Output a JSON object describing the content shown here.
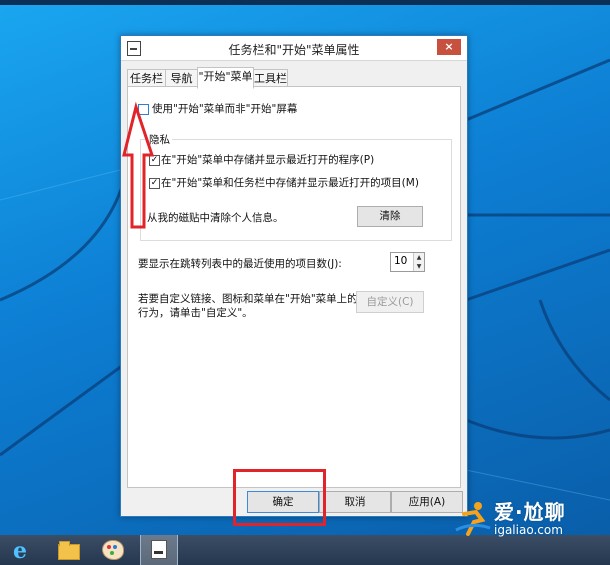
{
  "window": {
    "title": "任务栏和\"开始\"菜单属性",
    "close_glyph": "×"
  },
  "tabs": [
    {
      "label": "任务栏",
      "active": false
    },
    {
      "label": "导航",
      "active": false
    },
    {
      "label": "\"开始\"菜单",
      "active": true
    },
    {
      "label": "工具栏",
      "active": false
    }
  ],
  "start_menu": {
    "use_start_menu_label": "使用\"开始\"菜单而非\"开始\"屏幕",
    "use_start_menu_checked": false
  },
  "privacy": {
    "group_title": "隐私",
    "store_recent_programs_label": "在\"开始\"菜单中存储并显示最近打开的程序(P)",
    "store_recent_programs_checked": true,
    "store_recent_items_label": "在\"开始\"菜单和任务栏中存储并显示最近打开的项目(M)",
    "store_recent_items_checked": true,
    "clear_tiles_text": "从我的磁贴中清除个人信息。",
    "clear_button": "清除"
  },
  "jump_list": {
    "label": "要显示在跳转列表中的最近使用的项目数(J):",
    "value": "10"
  },
  "customize": {
    "text_line1": "若要自定义链接、图标和菜单在\"开始\"菜单上的外观和",
    "text_line2": "行为，请单击\"自定义\"。",
    "button": "自定义(C)"
  },
  "footer": {
    "ok": "确定",
    "cancel": "取消",
    "apply": "应用(A)"
  },
  "taskbar": {
    "items": [
      {
        "name": "internet-explorer",
        "icon": "ie-icon",
        "active": false
      },
      {
        "name": "file-explorer",
        "icon": "folder-icon",
        "active": false
      },
      {
        "name": "paint",
        "icon": "paint-icon",
        "active": false
      },
      {
        "name": "taskbar-properties",
        "icon": "properties-icon",
        "active": true
      }
    ]
  },
  "watermark": {
    "line1": "爱·尬聊",
    "line2": "igaliao.com"
  },
  "colors": {
    "annotation_red": "#e0242a",
    "close_red": "#c7503f",
    "desktop_blue": "#0d7ed3"
  }
}
